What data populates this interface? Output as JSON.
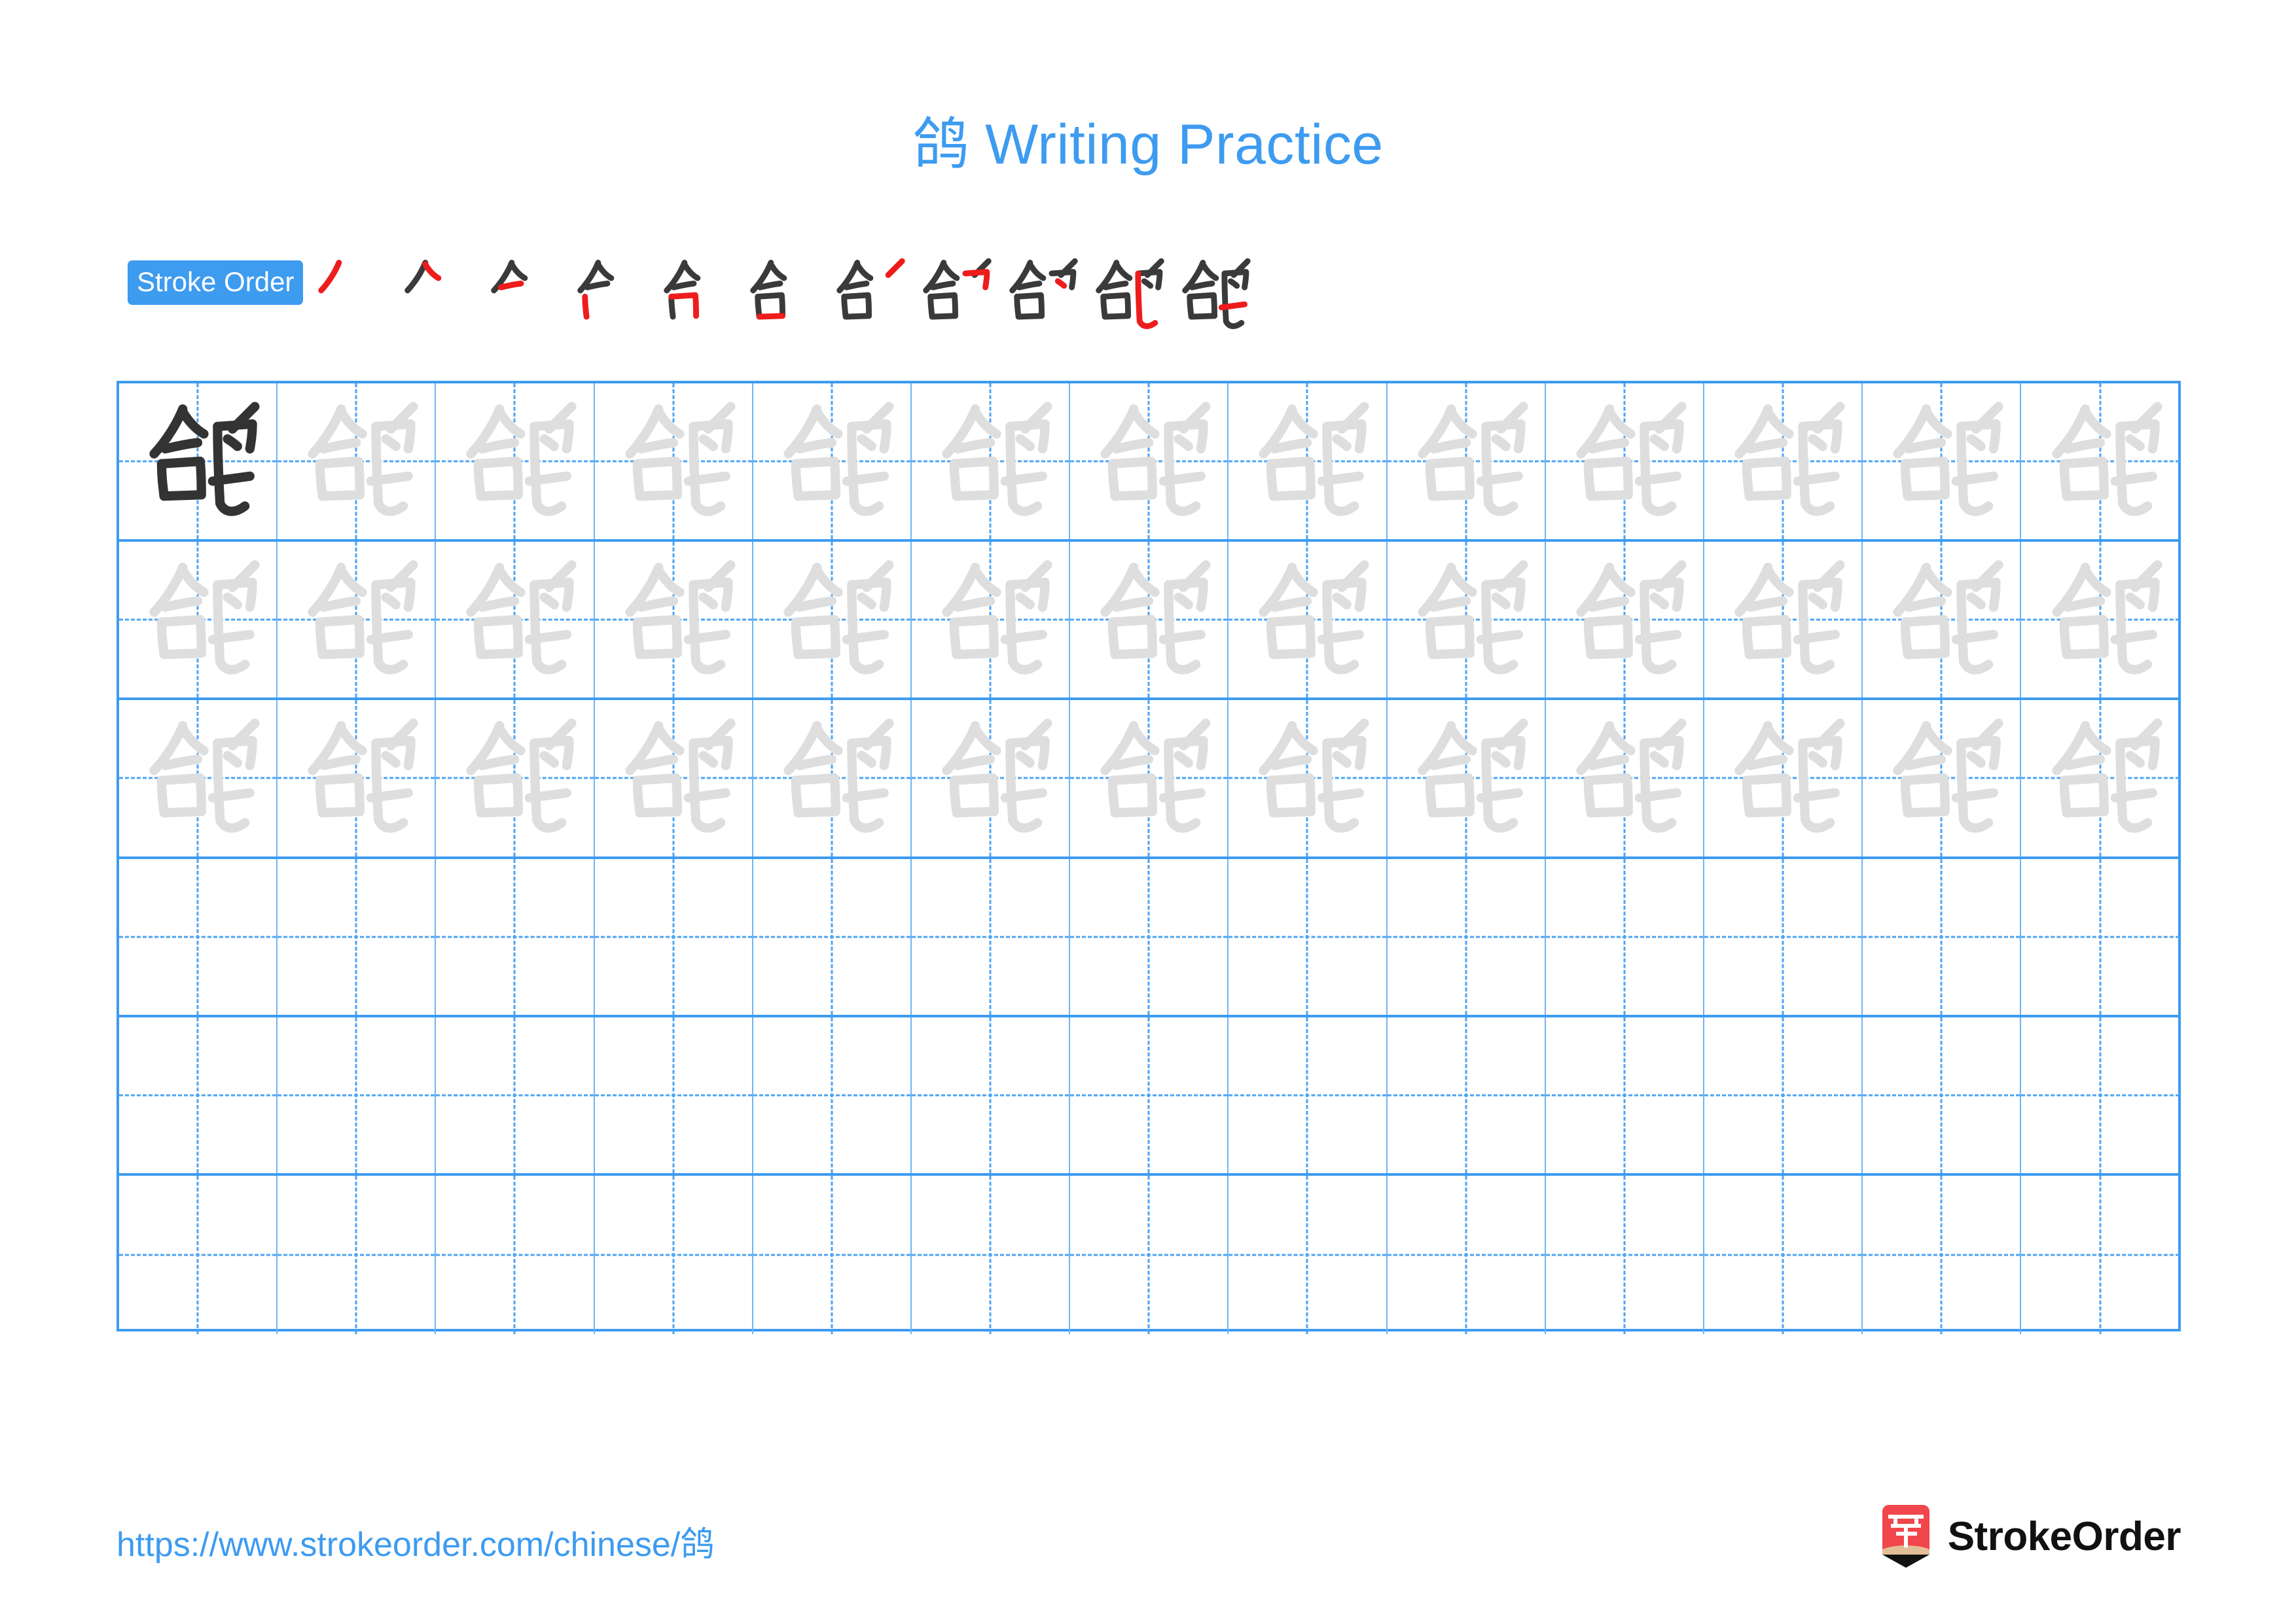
{
  "document": {
    "character": "鸽",
    "title_suffix": " Writing Practice",
    "title_full": "鸽 Writing Practice"
  },
  "colors": {
    "accent_blue": "#3D9BF0",
    "grid_line_blue": "#6FB4F3",
    "guide_dash_blue": "#4DA4F2",
    "character_dark": "#333333",
    "character_ghost": "#DEDEDE",
    "stroke_new_red": "#EE1C1C",
    "stroke_done_dark": "#3A3A3A",
    "logo_red": "#F1464B",
    "logo_wood": "#E2BE97"
  },
  "stroke_order": {
    "badge_label": "Stroke Order",
    "total_steps": 11,
    "steps": [
      {
        "index": 1,
        "strokes_drawn": 1,
        "new_stroke_color": "#EE1C1C"
      },
      {
        "index": 2,
        "strokes_drawn": 2,
        "new_stroke_color": "#EE1C1C"
      },
      {
        "index": 3,
        "strokes_drawn": 3,
        "new_stroke_color": "#EE1C1C"
      },
      {
        "index": 4,
        "strokes_drawn": 4,
        "new_stroke_color": "#EE1C1C"
      },
      {
        "index": 5,
        "strokes_drawn": 5,
        "new_stroke_color": "#EE1C1C"
      },
      {
        "index": 6,
        "strokes_drawn": 6,
        "new_stroke_color": "#EE1C1C"
      },
      {
        "index": 7,
        "strokes_drawn": 7,
        "new_stroke_color": "#EE1C1C"
      },
      {
        "index": 8,
        "strokes_drawn": 8,
        "new_stroke_color": "#EE1C1C"
      },
      {
        "index": 9,
        "strokes_drawn": 9,
        "new_stroke_color": "#EE1C1C"
      },
      {
        "index": 10,
        "strokes_drawn": 10,
        "new_stroke_color": "#EE1C1C"
      },
      {
        "index": 11,
        "strokes_drawn": 11,
        "new_stroke_color": "#EE1C1C"
      }
    ]
  },
  "practice_grid": {
    "columns": 13,
    "rows": 6,
    "cells": [
      [
        "dark",
        "ghost",
        "ghost",
        "ghost",
        "ghost",
        "ghost",
        "ghost",
        "ghost",
        "ghost",
        "ghost",
        "ghost",
        "ghost",
        "ghost"
      ],
      [
        "ghost",
        "ghost",
        "ghost",
        "ghost",
        "ghost",
        "ghost",
        "ghost",
        "ghost",
        "ghost",
        "ghost",
        "ghost",
        "ghost",
        "ghost"
      ],
      [
        "ghost",
        "ghost",
        "ghost",
        "ghost",
        "ghost",
        "ghost",
        "ghost",
        "ghost",
        "ghost",
        "ghost",
        "ghost",
        "ghost",
        "ghost"
      ],
      [
        "empty",
        "empty",
        "empty",
        "empty",
        "empty",
        "empty",
        "empty",
        "empty",
        "empty",
        "empty",
        "empty",
        "empty",
        "empty"
      ],
      [
        "empty",
        "empty",
        "empty",
        "empty",
        "empty",
        "empty",
        "empty",
        "empty",
        "empty",
        "empty",
        "empty",
        "empty",
        "empty"
      ],
      [
        "empty",
        "empty",
        "empty",
        "empty",
        "empty",
        "empty",
        "empty",
        "empty",
        "empty",
        "empty",
        "empty",
        "empty",
        "empty"
      ]
    ]
  },
  "footer": {
    "url": "https://www.strokeorder.com/chinese/鸽",
    "brand_name": "StrokeOrder",
    "logo_glyph": "字"
  }
}
